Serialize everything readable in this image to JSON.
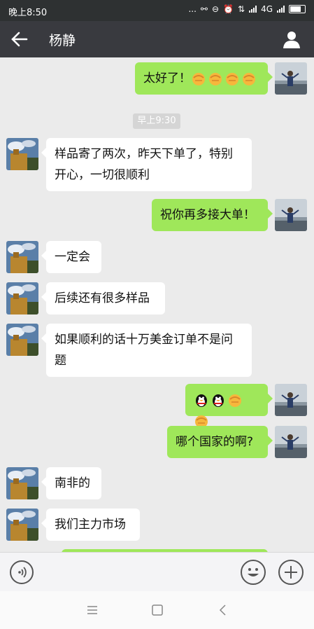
{
  "status": {
    "time": "晚上8:50",
    "network": "4G",
    "dots": "..."
  },
  "header": {
    "title": "杨静"
  },
  "chat": {
    "time_badge": "早上9:30",
    "messages": [
      {
        "side": "right",
        "text": "太好了！",
        "emojis": [
          "fist-emoji",
          "fist-emoji",
          "fist-emoji",
          "fist-emoji"
        ]
      },
      {
        "side": "left",
        "lines": [
          "样品寄了两次，昨天下单了，特别",
          "开心，一切很顺利"
        ]
      },
      {
        "side": "right",
        "text": "祝你再多接大单！"
      },
      {
        "side": "left",
        "text": "一定会"
      },
      {
        "side": "left",
        "text": "后续还有很多样品"
      },
      {
        "side": "left",
        "lines": [
          "如果顺利的话十万美金订单不是问",
          "题"
        ]
      },
      {
        "side": "right",
        "text": "",
        "emojis": [
          "penguin-emoji",
          "penguin-emoji",
          "fist-emoji",
          "fist-emoji"
        ]
      },
      {
        "side": "right",
        "text": "哪个国家的啊?"
      },
      {
        "side": "left",
        "text": "南非的"
      },
      {
        "side": "left",
        "text": "我们主力市场"
      }
    ]
  },
  "colors": {
    "titlebar": "#393a3f",
    "statusbar": "#2e3132",
    "right_bubble": "#9fe75a",
    "left_bubble": "#ffffff",
    "chat_bg": "#ebebeb"
  }
}
